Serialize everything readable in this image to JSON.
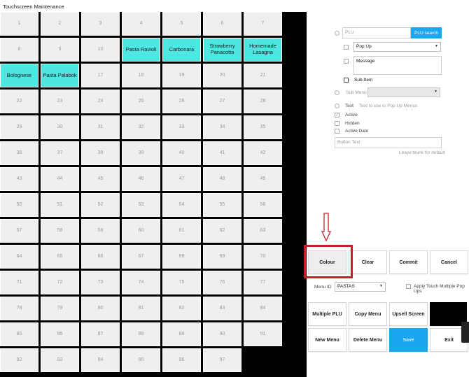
{
  "window": {
    "title": "Touchscreen Maintenance"
  },
  "grid": {
    "cells": [
      "1",
      "2",
      "3",
      "4",
      "5",
      "6",
      "7",
      "8",
      "9",
      "10",
      "Pasta Ravioli",
      "Carbonara",
      "Strawberry Panacotta",
      "Homemade Lasagna",
      "Bolognese",
      "Pasta Palabok",
      "17",
      "18",
      "19",
      "20",
      "21",
      "22",
      "23",
      "24",
      "25",
      "26",
      "27",
      "28",
      "29",
      "30",
      "31",
      "32",
      "33",
      "34",
      "35",
      "36",
      "37",
      "38",
      "39",
      "40",
      "41",
      "42",
      "43",
      "44",
      "45",
      "46",
      "47",
      "48",
      "49",
      "50",
      "51",
      "52",
      "53",
      "54",
      "55",
      "56",
      "57",
      "58",
      "59",
      "60",
      "61",
      "62",
      "63",
      "64",
      "65",
      "66",
      "67",
      "68",
      "69",
      "70",
      "71",
      "72",
      "73",
      "74",
      "75",
      "76",
      "77",
      "78",
      "79",
      "80",
      "81",
      "82",
      "83",
      "84",
      "85",
      "86",
      "87",
      "88",
      "89",
      "90",
      "91",
      "92",
      "93",
      "94",
      "95",
      "96",
      "97"
    ],
    "active_indices": [
      10,
      11,
      12,
      13,
      14,
      15
    ]
  },
  "form": {
    "plu_placeholder": "PLU",
    "plu_search_label": "PLU search",
    "popup_value": "Pop Up",
    "message_label": "Message",
    "subitem_label": "Sub-Item",
    "submenu_label": "Sub Menu",
    "text_label": "Text",
    "text_hint": "Text to use in Pop Up Menus",
    "active_label": "Active",
    "hidden_label": "Hidden",
    "active_date_label": "Active Date",
    "button_text_placeholder": "Button Text",
    "leave_blank_hint": "Leave blank for default"
  },
  "actions": {
    "colour": "Colour",
    "clear": "Clear",
    "commit": "Commit",
    "cancel": "Cancel",
    "menu_id_label": "Menu ID",
    "menu_id_value": "PASTAS",
    "apply_touch_label": "Apply Touch Multiple Pop Ups",
    "multiple_plu": "Multiple PLU",
    "copy_menu": "Copy Menu",
    "upsell_screen": "Upsell Screen",
    "new_menu": "New Menu",
    "delete_menu": "Delete Menu",
    "save": "Save",
    "exit": "Exit"
  },
  "colors": {
    "active_cell": "#4ee6e0",
    "accent_blue": "#1aa7f0",
    "annotation_red": "#c81e2a"
  }
}
